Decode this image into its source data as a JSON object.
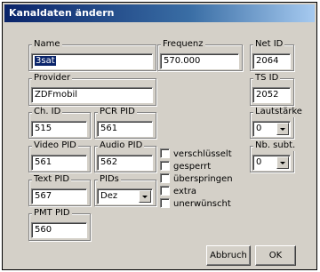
{
  "title": "Kanaldaten ändern",
  "fields": {
    "name": {
      "label": "Name",
      "value": "3sat"
    },
    "frequenz": {
      "label": "Frequenz",
      "value": "570.000"
    },
    "net_id": {
      "label": "Net ID",
      "value": "2064"
    },
    "provider": {
      "label": "Provider",
      "value": "ZDFmobil"
    },
    "ts_id": {
      "label": "TS ID",
      "value": "2052"
    },
    "ch_id": {
      "label": "Ch. ID",
      "value": "515"
    },
    "pcr_pid": {
      "label": "PCR PID",
      "value": "561"
    },
    "lautstaerke": {
      "label": "Lautstärke",
      "value": "0"
    },
    "video_pid": {
      "label": "Video PID",
      "value": "561"
    },
    "audio_pid": {
      "label": "Audio PID",
      "value": "562"
    },
    "nb_subt": {
      "label": "Nb. subt.",
      "value": "0"
    },
    "text_pid": {
      "label": "Text PID",
      "value": "567"
    },
    "pids": {
      "label": "PIDs",
      "value": "Dez"
    },
    "pmt_pid": {
      "label": "PMT PID",
      "value": "560"
    }
  },
  "checkboxes": [
    {
      "label": "verschlüsselt",
      "checked": false
    },
    {
      "label": "gesperrt",
      "checked": false
    },
    {
      "label": "überspringen",
      "checked": false
    },
    {
      "label": "extra",
      "checked": false
    },
    {
      "label": "unerwünscht",
      "checked": false
    }
  ],
  "buttons": {
    "cancel": "Abbruch",
    "ok": "OK"
  }
}
